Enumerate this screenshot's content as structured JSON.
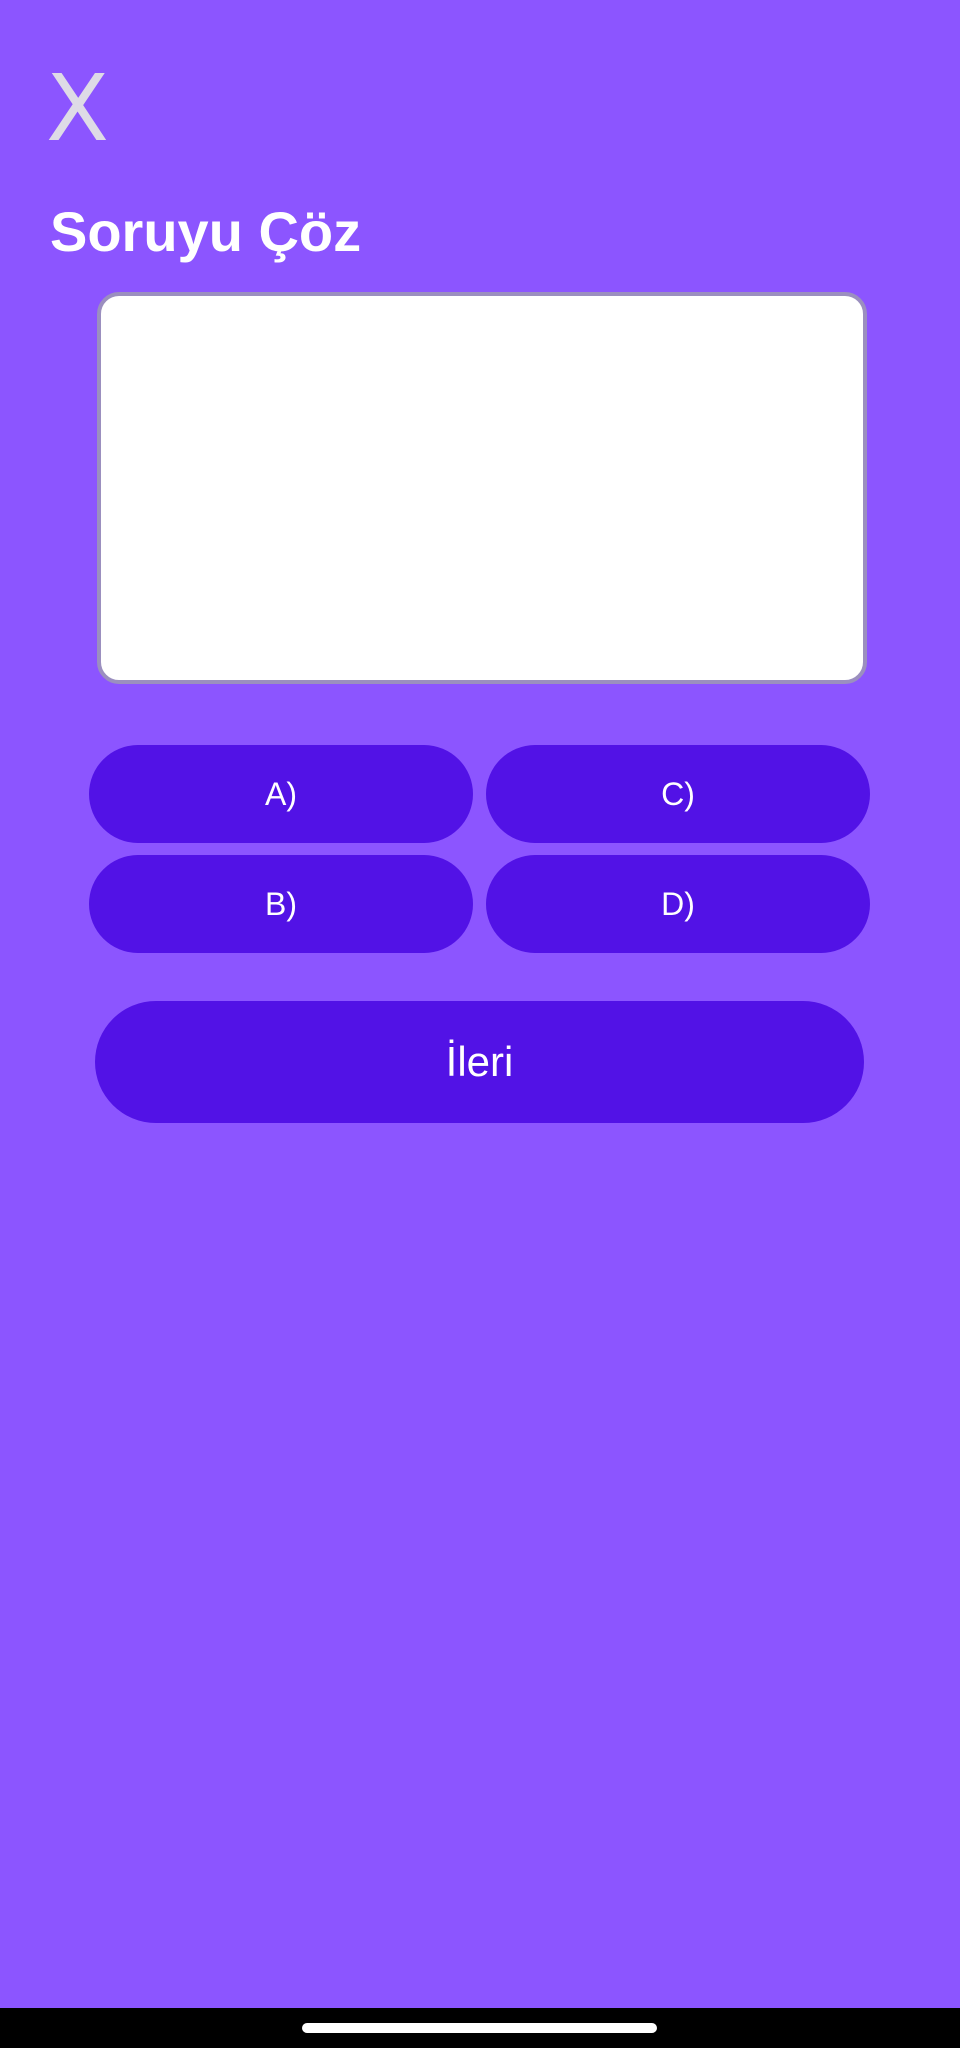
{
  "header": {
    "close_label": "X",
    "title": "Soruyu Çöz"
  },
  "question": {
    "text": ""
  },
  "options": {
    "a": "A)",
    "b": "B)",
    "c": "C)",
    "d": "D)"
  },
  "next_label": "İleri",
  "colors": {
    "background": "#8c55ff",
    "button": "#5212e6",
    "close_icon": "#dedbe6"
  }
}
